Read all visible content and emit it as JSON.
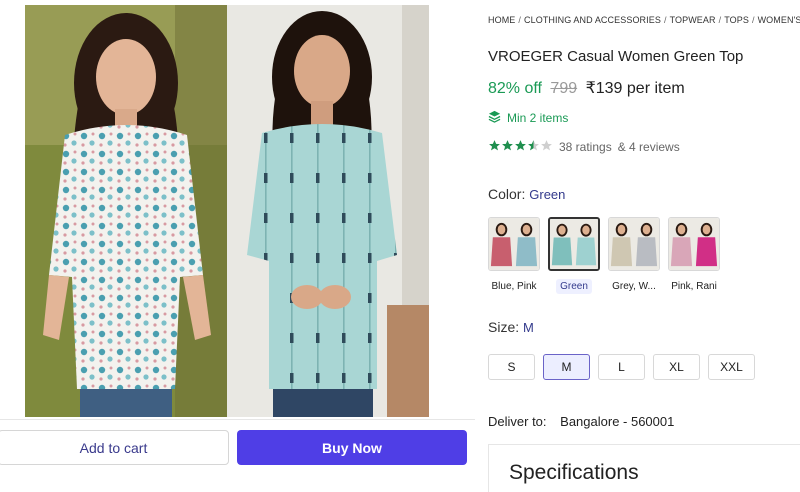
{
  "breadcrumb": [
    "HOME",
    "CLOTHING AND ACCESSORIES",
    "TOPWEAR",
    "TOPS",
    "WOMEN'S TOPS"
  ],
  "product": {
    "title": "VROEGER Casual Women Green Top",
    "discount": "82% off",
    "mrp": "799",
    "price": "₹139 per item",
    "min_order": "Min 2 items",
    "rating_value": 3.5,
    "ratings_text": "38 ratings",
    "reviews_text": "& 4 reviews"
  },
  "color": {
    "label": "Color:",
    "selected": "Green",
    "options": [
      {
        "label": "Blue, Pink",
        "c1": "#c85f6e",
        "c2": "#8fbcc8",
        "selected": false
      },
      {
        "label": "Green",
        "c1": "#7fbfbc",
        "c2": "#9ed1d0",
        "selected": true
      },
      {
        "label": "Grey, W...",
        "c1": "#cfc7b2",
        "c2": "#b9bcc2",
        "selected": false
      },
      {
        "label": "Pink, Rani",
        "c1": "#d9a6b8",
        "c2": "#d12f86",
        "selected": false
      }
    ]
  },
  "size": {
    "label": "Size:",
    "selected": "M",
    "options": [
      "S",
      "M",
      "L",
      "XL",
      "XXL"
    ]
  },
  "delivery": {
    "label": "Deliver to:",
    "location": "Bangalore - 560001"
  },
  "actions": {
    "add_to_cart": "Add to cart",
    "buy_now": "Buy Now"
  },
  "specifications": {
    "title": "Specifications"
  },
  "colors": {
    "accent": "#4f3ee6",
    "green": "#1a9a55",
    "star": "#1f8f4e"
  },
  "icons": {
    "min_order": "layers-icon",
    "rating": "star-icon"
  }
}
